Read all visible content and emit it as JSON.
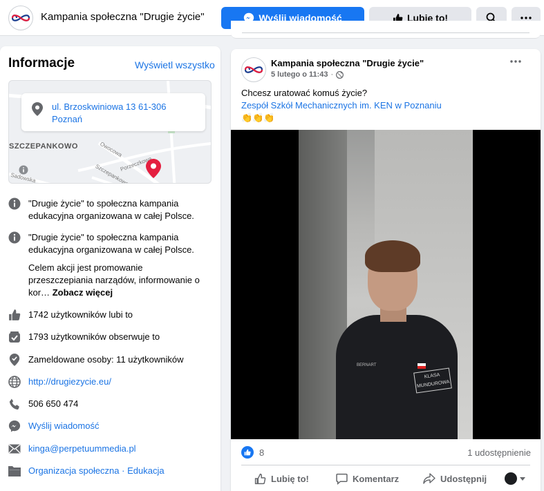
{
  "header": {
    "page_name": "Kampania społeczna \"Drugie życie\"",
    "message_button": "Wyślij wiadomość",
    "like_button": "Lubię to!"
  },
  "info": {
    "title": "Informacje",
    "view_all": "Wyświetl wszystko",
    "address_line1": "ul. Brzoskwiniowa 13 61-306",
    "address_line2": "Poznań",
    "map_labels": {
      "district": "SZCZEPANKOWO",
      "street1": "Owocowa",
      "street2": "Porzeczkowa",
      "street3": "Szczepankowo",
      "street4": "Sadowska"
    },
    "about_1": "\"Drugie życie\" to społeczna kampania edukacyjna organizowana w całej Polsce.",
    "about_2": "\"Drugie życie\" to społeczna kampania edukacyjna organizowana w całej Polsce.",
    "about_2_more": "Celem akcji jest promowanie przeszczepiania narządów, informowanie o kor…",
    "see_more": "Zobacz więcej",
    "likes": "1742 użytkowników lubi to",
    "followers": "1793 użytkowników obserwuje to",
    "checkins": "Zameldowane osoby: 11 użytkowników",
    "website": "http://drugiezycie.eu/",
    "phone": "506 650 474",
    "send_message": "Wyślij wiadomość",
    "email": "kinga@perpetuummedia.pl",
    "category_1": "Organizacja społeczna",
    "category_sep": " · ",
    "category_2": "Edukacja"
  },
  "post": {
    "author": "Kampania społeczna \"Drugie życie\"",
    "date": "5 lutego o 11:43",
    "text_line1": "Chcesz uratować komuś życie?",
    "text_link": "Zespół Szkół Mechanicznych im. KEN w Poznaniu",
    "claps": "👏👏👏",
    "video": {
      "name_tag": "BERNART",
      "badge": "KLASA MUNDUROWA"
    },
    "reaction_count": "8",
    "shares": "1 udostępnienie",
    "actions": {
      "like": "Lubię to!",
      "comment": "Komentarz",
      "share": "Udostępnij"
    }
  },
  "colors": {
    "primary": "#1877f2",
    "link": "#1b74e4",
    "map_pin": "#e41e3f"
  }
}
